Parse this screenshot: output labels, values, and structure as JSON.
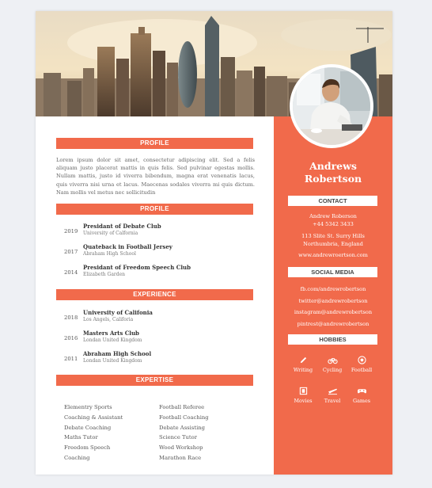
{
  "left": {
    "sections": {
      "profile_1": "PROFILE",
      "profile_2": "PROFILE",
      "experience": "EXPERIENCE",
      "expertise": "EXPERTISE"
    },
    "profile_text": "Lorem ipsum dolor sit amet, consectetur adipiscing elit. Sed a felis aliquam justo placerat mattis in quis felis. Sed pulvinar egestas mollis. Nullam mattis, justo id viverra bibendum, magna erat venenatis lacus, quis viverra nisi urna et lacus. Maecenas sodales viverra mi quis dictum. Nam mollis vel metus nec sollicitudin",
    "achievements": [
      {
        "year": "2019",
        "title": "Presidant of Debate Club",
        "sub": "University of Calfornia"
      },
      {
        "year": "2017",
        "title": "Quateback in Football Jersey",
        "sub": "Abraham High School"
      },
      {
        "year": "2014",
        "title": "Presidant of Freedom Speech Club",
        "sub": "Elizabeth Garden"
      }
    ],
    "experience": [
      {
        "year": "2018",
        "title": "University of Califonia",
        "sub": "Los Angels, Califoria"
      },
      {
        "year": "2016",
        "title": "Masters Arts Club",
        "sub": "Londan United Kingdom"
      },
      {
        "year": "2011",
        "title": "Abraham High School",
        "sub": "Londan United Kingdom"
      }
    ],
    "expertise_col1": [
      "Elementry Sports",
      "Coaching & Assistant",
      "Debate Coaching",
      "Maths Tutor",
      "Freedom Speech",
      "Coaching"
    ],
    "expertise_col2": [
      "Football Referee",
      "Football Coaching",
      "Debate Assisting",
      "Science Tutor",
      "Wood Workshop",
      "Marathon Race"
    ]
  },
  "right": {
    "first_name": "Andrews",
    "last_name": "Robertson",
    "contact_header": "CONTACT",
    "contact": {
      "name": "Andrew Roberson",
      "phone": "+44 5342 3433",
      "address1": "113 Slite St. Surry Hills",
      "address2": "Northumbria, England",
      "website": "www.andrewroertson.com"
    },
    "social_header": "SOCIAL MEDIA",
    "social": [
      "fb.com/andrewrobertson",
      "twitter@andrewrobertson",
      "instagram@andrewrobertson",
      "pintrest@andrewrobertson"
    ],
    "hobbies_header": "HOBBIES",
    "hobbies": [
      {
        "label": "Writing",
        "icon": "pencil-icon"
      },
      {
        "label": "Cycling",
        "icon": "bicycle-icon"
      },
      {
        "label": "Football",
        "icon": "football-icon"
      },
      {
        "label": "Movies",
        "icon": "film-icon"
      },
      {
        "label": "Travel",
        "icon": "airplane-icon"
      },
      {
        "label": "Games",
        "icon": "gamepad-icon"
      }
    ]
  },
  "colors": {
    "accent": "#f16a4b",
    "background": "#eef0f4",
    "page": "#ffffff"
  }
}
